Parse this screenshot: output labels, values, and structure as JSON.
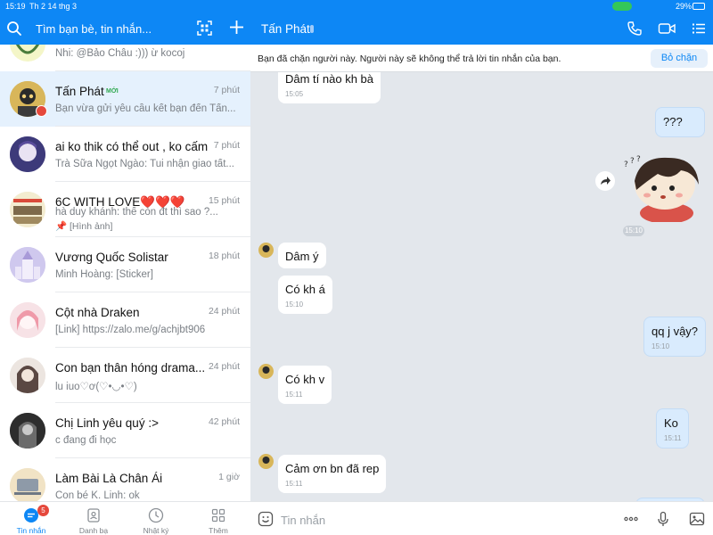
{
  "status_bar": {
    "time": "15:19",
    "date": "Th 2 14 thg 3",
    "battery": "29%"
  },
  "left": {
    "search_placeholder": "Tìm bạn bè, tin nhắn...",
    "partial_top_preview": "Nhi: @Bảo Châu :))) ừ kocoj",
    "conversations": [
      {
        "name": "Tấn Phát",
        "badge": "MỚI",
        "time": "7 phút",
        "preview": "Bạn vừa gửi yêu cầu kết bạn đến Tấn..."
      },
      {
        "name": "ai ko thik có thể out , ko cấm",
        "time": "7 phút",
        "preview": "Trà Sữa Ngọt Ngào: Tui nhận giao tất..."
      },
      {
        "name": "6C WITH LOVE❤️❤️❤️",
        "time": "15 phút",
        "preview": "hà duy khánh: thế còn đt thì sao ?...",
        "preview2": "📌 [Hình ảnh]"
      },
      {
        "name": "Vương Quốc Solistar",
        "time": "18 phút",
        "preview": "Minh Hoàng: [Sticker]"
      },
      {
        "name": "Cột nhà Draken",
        "time": "24 phút",
        "preview": "[Link] https://zalo.me/g/achjbt906"
      },
      {
        "name": "Con bạn thân hóng drama...",
        "time": "24 phút",
        "preview": "lu iuo♡ơ(♡•◡•♡)"
      },
      {
        "name": "Chị Linh yêu quý :>",
        "time": "42 phút",
        "preview": "c đang đi học"
      },
      {
        "name": "Làm Bài Là Chân Ái",
        "time": "1 giờ",
        "preview": "Con bé K. Linh: ok"
      }
    ],
    "nav": {
      "messages": "Tin nhắn",
      "messages_badge": "5",
      "contacts": "Danh bạ",
      "diary": "Nhật ký",
      "more": "Thêm"
    }
  },
  "right": {
    "title": "Tấn Phát",
    "blocked_message": "Bạn đã chặn người này. Người này sẽ không thể trả lời tin nhắn của bạn.",
    "unblock_label": "Bỏ chặn",
    "sticker_time": "15:10",
    "input_placeholder": "Tin nhắn",
    "messages": [
      {
        "dir": "in",
        "text": "Dâm tí nào kh bà",
        "time": "15:05"
      },
      {
        "dir": "out",
        "text": "???"
      },
      {
        "dir": "in",
        "text": "Dâm ý"
      },
      {
        "dir": "in",
        "text": "Có kh á",
        "time": "15:10"
      },
      {
        "dir": "out",
        "text": "qq j vậy?",
        "time": "15:10"
      },
      {
        "dir": "in",
        "text": "Có kh v",
        "time": "15:11"
      },
      {
        "dir": "out",
        "text": "Ko",
        "time": "15:11"
      },
      {
        "dir": "in",
        "text": "Cảm ơn bn đã rep",
        "time": "15:11"
      }
    ]
  },
  "colors": {
    "header_blue": "#0d87f5",
    "selected_row": "#e5f1fd",
    "chat_bg": "#e3e7ec",
    "out_bubble": "#d9ebfd"
  }
}
